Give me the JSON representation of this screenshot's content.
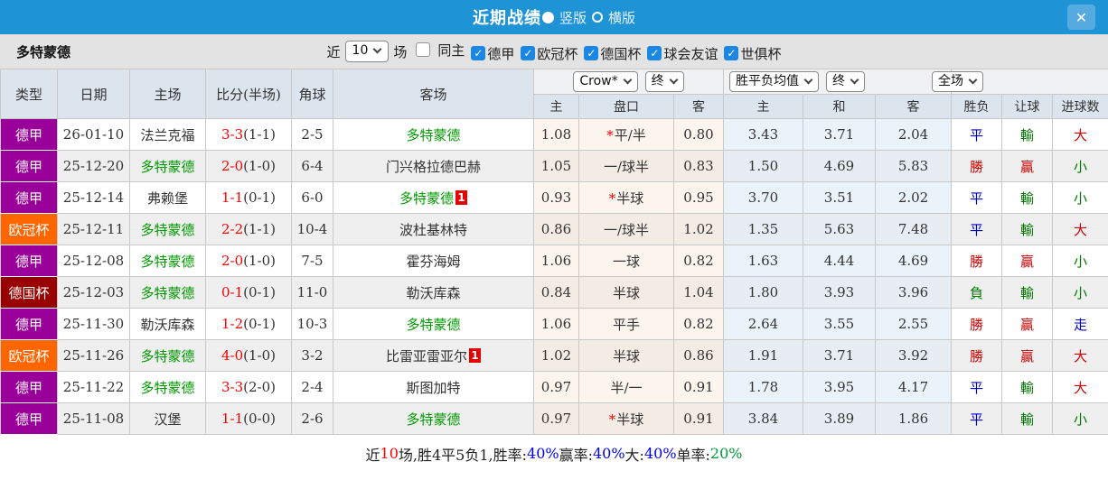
{
  "titlebar": {
    "title": "近期战绩",
    "layout_options": [
      {
        "label": "竖版",
        "selected": true
      },
      {
        "label": "横版",
        "selected": false
      }
    ],
    "close_label": "✕"
  },
  "filters": {
    "team": "多特蒙德",
    "recent_prefix": "近",
    "recent_count": "10",
    "recent_suffix": "场",
    "checkboxes": [
      {
        "label": "同主",
        "checked": false
      },
      {
        "label": "德甲",
        "checked": true
      },
      {
        "label": "欧冠杯",
        "checked": true
      },
      {
        "label": "德国杯",
        "checked": true
      },
      {
        "label": "球会友谊",
        "checked": true
      },
      {
        "label": "世俱杯",
        "checked": true
      }
    ]
  },
  "table": {
    "main_headers": [
      "类型",
      "日期",
      "主场",
      "比分(半场)",
      "角球",
      "客场"
    ],
    "selects": {
      "company": "Crow*",
      "company_stage": "终",
      "mean": "胜平负均值",
      "mean_stage": "终",
      "scope": "全场"
    },
    "sub_headers": [
      "主",
      "盘口",
      "客",
      "主",
      "和",
      "客",
      "胜负",
      "让球",
      "进球数"
    ],
    "rows": [
      {
        "league": "德甲",
        "color": "#990099",
        "date": "26-01-10",
        "home": "法兰克福",
        "home_hl": false,
        "home_badge": "",
        "score": "3-3",
        "half": "(1-1)",
        "corner": "2-5",
        "away": "多特蒙德",
        "away_hl": true,
        "away_badge": "",
        "crow": [
          "1.08",
          "*平/半",
          "0.80"
        ],
        "mean": [
          "3.43",
          "3.71",
          "2.04"
        ],
        "results": [
          [
            "平",
            "blue"
          ],
          [
            "輸",
            "green"
          ],
          [
            "大",
            "red"
          ]
        ]
      },
      {
        "league": "德甲",
        "color": "#990099",
        "date": "25-12-20",
        "home": "多特蒙德",
        "home_hl": true,
        "home_badge": "",
        "score": "2-0",
        "half": "(1-0)",
        "corner": "6-4",
        "away": "门兴格拉德巴赫",
        "away_hl": false,
        "away_badge": "",
        "crow": [
          "1.05",
          "一/球半",
          "0.83"
        ],
        "mean": [
          "1.50",
          "4.69",
          "5.83"
        ],
        "results": [
          [
            "勝",
            "red"
          ],
          [
            "贏",
            "red"
          ],
          [
            "小",
            "green"
          ]
        ]
      },
      {
        "league": "德甲",
        "color": "#990099",
        "date": "25-12-14",
        "home": "弗赖堡",
        "home_hl": false,
        "home_badge": "",
        "score": "1-1",
        "half": "(0-1)",
        "corner": "6-0",
        "away": "多特蒙德",
        "away_hl": true,
        "away_badge": "1",
        "crow": [
          "0.93",
          "*半球",
          "0.95"
        ],
        "mean": [
          "3.70",
          "3.51",
          "2.02"
        ],
        "results": [
          [
            "平",
            "blue"
          ],
          [
            "輸",
            "green"
          ],
          [
            "小",
            "green"
          ]
        ]
      },
      {
        "league": "欧冠杯",
        "color": "#ff6600",
        "date": "25-12-11",
        "home": "多特蒙德",
        "home_hl": true,
        "home_badge": "",
        "score": "2-2",
        "half": "(1-1)",
        "corner": "10-4",
        "away": "波杜基林特",
        "away_hl": false,
        "away_badge": "",
        "crow": [
          "0.86",
          "一/球半",
          "1.02"
        ],
        "mean": [
          "1.35",
          "5.63",
          "7.48"
        ],
        "results": [
          [
            "平",
            "blue"
          ],
          [
            "輸",
            "green"
          ],
          [
            "大",
            "red"
          ]
        ]
      },
      {
        "league": "德甲",
        "color": "#990099",
        "date": "25-12-08",
        "home": "多特蒙德",
        "home_hl": true,
        "home_badge": "",
        "score": "2-0",
        "half": "(1-0)",
        "corner": "7-5",
        "away": "霍芬海姆",
        "away_hl": false,
        "away_badge": "",
        "crow": [
          "1.06",
          "一球",
          "0.82"
        ],
        "mean": [
          "1.63",
          "4.44",
          "4.69"
        ],
        "results": [
          [
            "勝",
            "red"
          ],
          [
            "贏",
            "red"
          ],
          [
            "小",
            "green"
          ]
        ]
      },
      {
        "league": "德国杯",
        "color": "#990000",
        "date": "25-12-03",
        "home": "多特蒙德",
        "home_hl": true,
        "home_badge": "",
        "score": "0-1",
        "half": "(0-1)",
        "corner": "11-0",
        "away": "勒沃库森",
        "away_hl": false,
        "away_badge": "",
        "crow": [
          "0.84",
          "半球",
          "1.04"
        ],
        "mean": [
          "1.80",
          "3.93",
          "3.96"
        ],
        "results": [
          [
            "負",
            "green"
          ],
          [
            "輸",
            "green"
          ],
          [
            "小",
            "green"
          ]
        ]
      },
      {
        "league": "德甲",
        "color": "#990099",
        "date": "25-11-30",
        "home": "勒沃库森",
        "home_hl": false,
        "home_badge": "",
        "score": "1-2",
        "half": "(0-1)",
        "corner": "10-3",
        "away": "多特蒙德",
        "away_hl": true,
        "away_badge": "",
        "crow": [
          "1.06",
          "平手",
          "0.82"
        ],
        "mean": [
          "2.64",
          "3.55",
          "2.55"
        ],
        "results": [
          [
            "勝",
            "red"
          ],
          [
            "贏",
            "red"
          ],
          [
            "走",
            "blue"
          ]
        ]
      },
      {
        "league": "欧冠杯",
        "color": "#ff6600",
        "date": "25-11-26",
        "home": "多特蒙德",
        "home_hl": true,
        "home_badge": "",
        "score": "4-0",
        "half": "(1-0)",
        "corner": "3-2",
        "away": "比雷亚雷亚尔",
        "away_hl": false,
        "away_badge": "1",
        "crow": [
          "1.02",
          "半球",
          "0.86"
        ],
        "mean": [
          "1.91",
          "3.71",
          "3.92"
        ],
        "results": [
          [
            "勝",
            "red"
          ],
          [
            "贏",
            "red"
          ],
          [
            "大",
            "red"
          ]
        ]
      },
      {
        "league": "德甲",
        "color": "#990099",
        "date": "25-11-22",
        "home": "多特蒙德",
        "home_hl": true,
        "home_badge": "",
        "score": "3-3",
        "half": "(2-0)",
        "corner": "2-4",
        "away": "斯图加特",
        "away_hl": false,
        "away_badge": "",
        "crow": [
          "0.97",
          "半/一",
          "0.91"
        ],
        "mean": [
          "1.78",
          "3.95",
          "4.17"
        ],
        "results": [
          [
            "平",
            "blue"
          ],
          [
            "輸",
            "green"
          ],
          [
            "大",
            "red"
          ]
        ]
      },
      {
        "league": "德甲",
        "color": "#990099",
        "date": "25-11-08",
        "home": "汉堡",
        "home_hl": false,
        "home_badge": "",
        "score": "1-1",
        "half": "(0-0)",
        "corner": "2-6",
        "away": "多特蒙德",
        "away_hl": true,
        "away_badge": "",
        "crow": [
          "0.97",
          "*半球",
          "0.91"
        ],
        "mean": [
          "3.84",
          "3.89",
          "1.86"
        ],
        "results": [
          [
            "平",
            "blue"
          ],
          [
            "輸",
            "green"
          ],
          [
            "小",
            "green"
          ]
        ]
      }
    ]
  },
  "footer": {
    "segments": [
      [
        "近",
        "k"
      ],
      [
        "10",
        "red"
      ],
      [
        "场,胜4平5负1, ",
        "k"
      ],
      [
        "胜率:",
        "k"
      ],
      [
        "40%",
        "blue"
      ],
      [
        " 赢率:",
        "k"
      ],
      [
        "40%",
        "blue"
      ],
      [
        " 大:",
        "k"
      ],
      [
        "40%",
        "blue"
      ],
      [
        " 单率:",
        "k"
      ],
      [
        "20%",
        "green"
      ]
    ]
  },
  "colors": {
    "topbar_blue": "#1e93d6",
    "close_button_blue": "#55aadf",
    "bundesliga_purple": "#990099",
    "champions_league_orange": "#ff6600",
    "dfb_pokal_darkred": "#990000",
    "team_highlight_green": "#009900",
    "score_red": "#ff0000",
    "win_red": "#cc0000",
    "draw_blue": "#0000cc",
    "lose_green": "#007700",
    "checkbox_blue": "#1b87e5",
    "crow_column_cream": "#fbf5ee",
    "mean_column_blue": "#eaf3fa",
    "header_bg": "#dce5ee"
  }
}
